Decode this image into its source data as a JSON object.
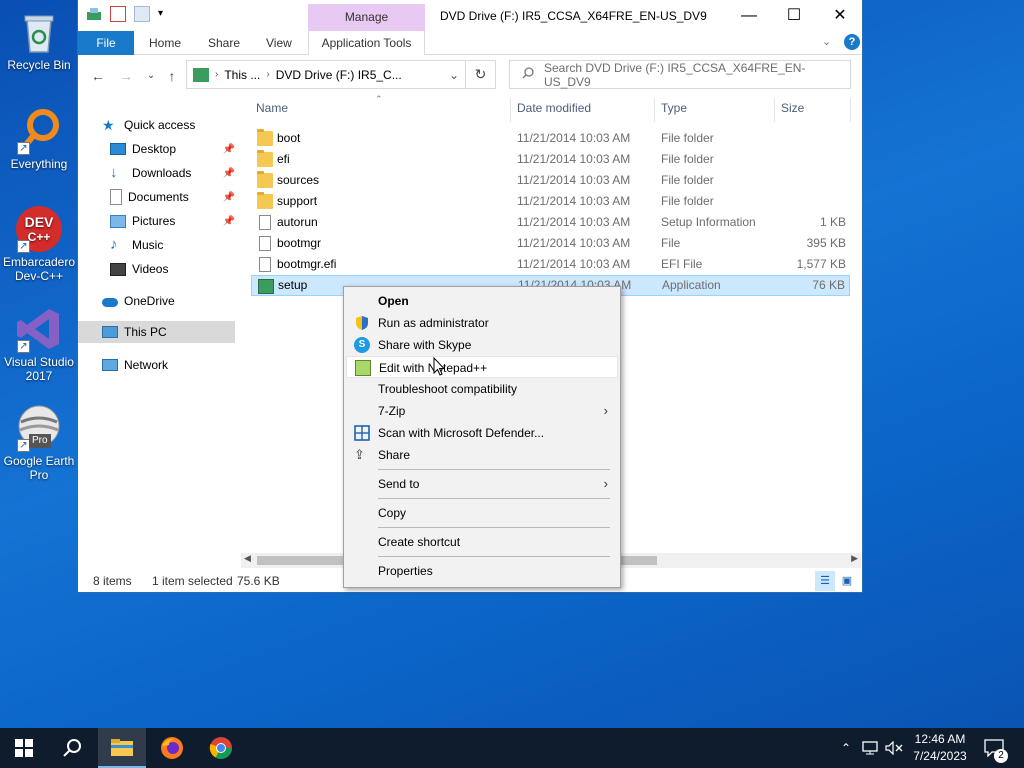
{
  "desktop": {
    "icons": [
      {
        "label": "Recycle Bin"
      },
      {
        "label": "Everything"
      },
      {
        "label": "Embarcadero Dev-C++"
      },
      {
        "label": "Visual Studio 2017"
      },
      {
        "label": "Google Earth Pro"
      }
    ],
    "devcpp_logo_line1": "DEV",
    "devcpp_logo_line2": "C++",
    "google_earth_badge": "Pro"
  },
  "window": {
    "title": "DVD Drive (F:) IR5_CCSA_X64FRE_EN-US_DV9",
    "manage_tab": "Manage",
    "ribbon_tabs": [
      "File",
      "Home",
      "Share",
      "View",
      "Application Tools"
    ],
    "address": {
      "part1": "This ...",
      "part2": "DVD Drive (F:) IR5_C..."
    },
    "search_placeholder": "Search DVD Drive (F:) IR5_CCSA_X64FRE_EN-US_DV9"
  },
  "navpane": {
    "items": [
      {
        "label": "Quick access"
      },
      {
        "label": "Desktop"
      },
      {
        "label": "Downloads"
      },
      {
        "label": "Documents"
      },
      {
        "label": "Pictures"
      },
      {
        "label": "Music"
      },
      {
        "label": "Videos"
      },
      {
        "label": "OneDrive"
      },
      {
        "label": "This PC"
      },
      {
        "label": "Network"
      }
    ]
  },
  "filelist": {
    "columns": {
      "name": "Name",
      "date": "Date modified",
      "type": "Type",
      "size": "Size"
    },
    "rows": [
      {
        "name": "boot",
        "date": "11/21/2014 10:03 AM",
        "type": "File folder",
        "size": ""
      },
      {
        "name": "efi",
        "date": "11/21/2014 10:03 AM",
        "type": "File folder",
        "size": ""
      },
      {
        "name": "sources",
        "date": "11/21/2014 10:03 AM",
        "type": "File folder",
        "size": ""
      },
      {
        "name": "support",
        "date": "11/21/2014 10:03 AM",
        "type": "File folder",
        "size": ""
      },
      {
        "name": "autorun",
        "date": "11/21/2014 10:03 AM",
        "type": "Setup Information",
        "size": "1 KB"
      },
      {
        "name": "bootmgr",
        "date": "11/21/2014 10:03 AM",
        "type": "File",
        "size": "395 KB"
      },
      {
        "name": "bootmgr.efi",
        "date": "11/21/2014 10:03 AM",
        "type": "EFI File",
        "size": "1,577 KB"
      },
      {
        "name": "setup",
        "date": "11/21/2014 10:03 AM",
        "type": "Application",
        "size": "76 KB"
      }
    ]
  },
  "status": {
    "items": "8 items",
    "selected": "1 item selected",
    "size": "75.6 KB"
  },
  "context_menu": {
    "items": [
      "Open",
      "Run as administrator",
      "Share with Skype",
      "Edit with Notepad++",
      "Troubleshoot compatibility",
      "7-Zip",
      "Scan with Microsoft Defender...",
      "Share",
      "Send to",
      "Copy",
      "Create shortcut",
      "Properties"
    ]
  },
  "taskbar": {
    "time": "12:46 AM",
    "date": "7/24/2023",
    "notification_count": "2"
  },
  "colors": {
    "accent": "#1979ca",
    "selection": "#cce8ff",
    "manage_tab": "#e8c9f4",
    "taskbar": "#0f1c2e"
  }
}
